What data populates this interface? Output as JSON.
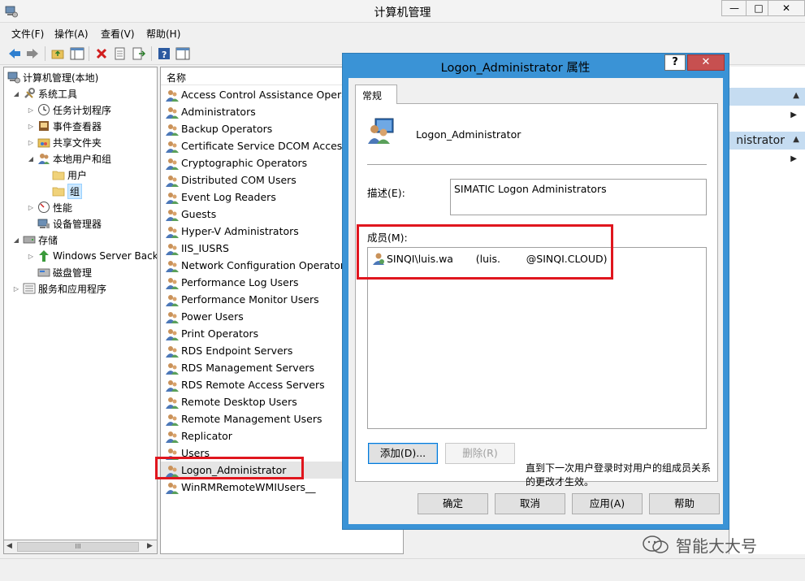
{
  "window": {
    "title": "计算机管理",
    "minimize": "—",
    "maximize": "□",
    "close": "✕",
    "icon": "computer-management-icon"
  },
  "menu": [
    "文件(F)",
    "操作(A)",
    "查看(V)",
    "帮助(H)"
  ],
  "toolbar": {
    "icons": [
      "back-arrow-icon",
      "forward-arrow-icon",
      "up-folder-icon",
      "show-hide-tree-icon",
      "delete-icon",
      "properties-icon",
      "export-list-icon",
      "help-icon",
      "action-pane-icon"
    ]
  },
  "tree": {
    "root": "计算机管理(本地)",
    "system_tools": "系统工具",
    "task_scheduler": "任务计划程序",
    "event_viewer": "事件查看器",
    "shared_folders": "共享文件夹",
    "local_users_groups": "本地用户和组",
    "users": "用户",
    "groups": "组",
    "performance": "性能",
    "device_manager": "设备管理器",
    "storage": "存储",
    "windows_server_backup": "Windows Server Back",
    "disk_management": "磁盘管理",
    "services_apps": "服务和应用程序",
    "scroll_thumb": "III"
  },
  "list": {
    "header": "名称",
    "rows": [
      "Access Control Assistance Opera...",
      "Administrators",
      "Backup Operators",
      "Certificate Service DCOM Access",
      "Cryptographic Operators",
      "Distributed COM Users",
      "Event Log Readers",
      "Guests",
      "Hyper-V Administrators",
      "IIS_IUSRS",
      "Network Configuration Operators",
      "Performance Log Users",
      "Performance Monitor Users",
      "Power Users",
      "Print Operators",
      "RDS Endpoint Servers",
      "RDS Management Servers",
      "RDS Remote Access Servers",
      "Remote Desktop Users",
      "Remote Management Users",
      "Replicator",
      "Users",
      "Logon_Administrator",
      "WinRMRemoteWMIUsers__"
    ],
    "selected": "Logon_Administrator"
  },
  "actions": {
    "header_suffix": "nistrator"
  },
  "dialog": {
    "title": "Logon_Administrator 属性",
    "help": "?",
    "close": "✕",
    "tab": "常规",
    "group_name": "Logon_Administrator",
    "desc_label": "描述(E):",
    "desc_value": "SIMATIC Logon Administrators",
    "members_label": "成员(M):",
    "member": "SINQI\\luis.wa       (luis.        @SINQI.CLOUD)",
    "add": "添加(D)...",
    "remove": "删除(R)",
    "note": "直到下一次用户登录时对用户的组成员关系的更改才生效。",
    "ok": "确定",
    "cancel": "取消",
    "apply": "应用(A)",
    "help_btn": "帮助"
  },
  "watermark": "智能大大号",
  "colors": {
    "dialog_frame": "#3a93d6",
    "close_button": "#c75050",
    "highlight": "#e0161e"
  }
}
